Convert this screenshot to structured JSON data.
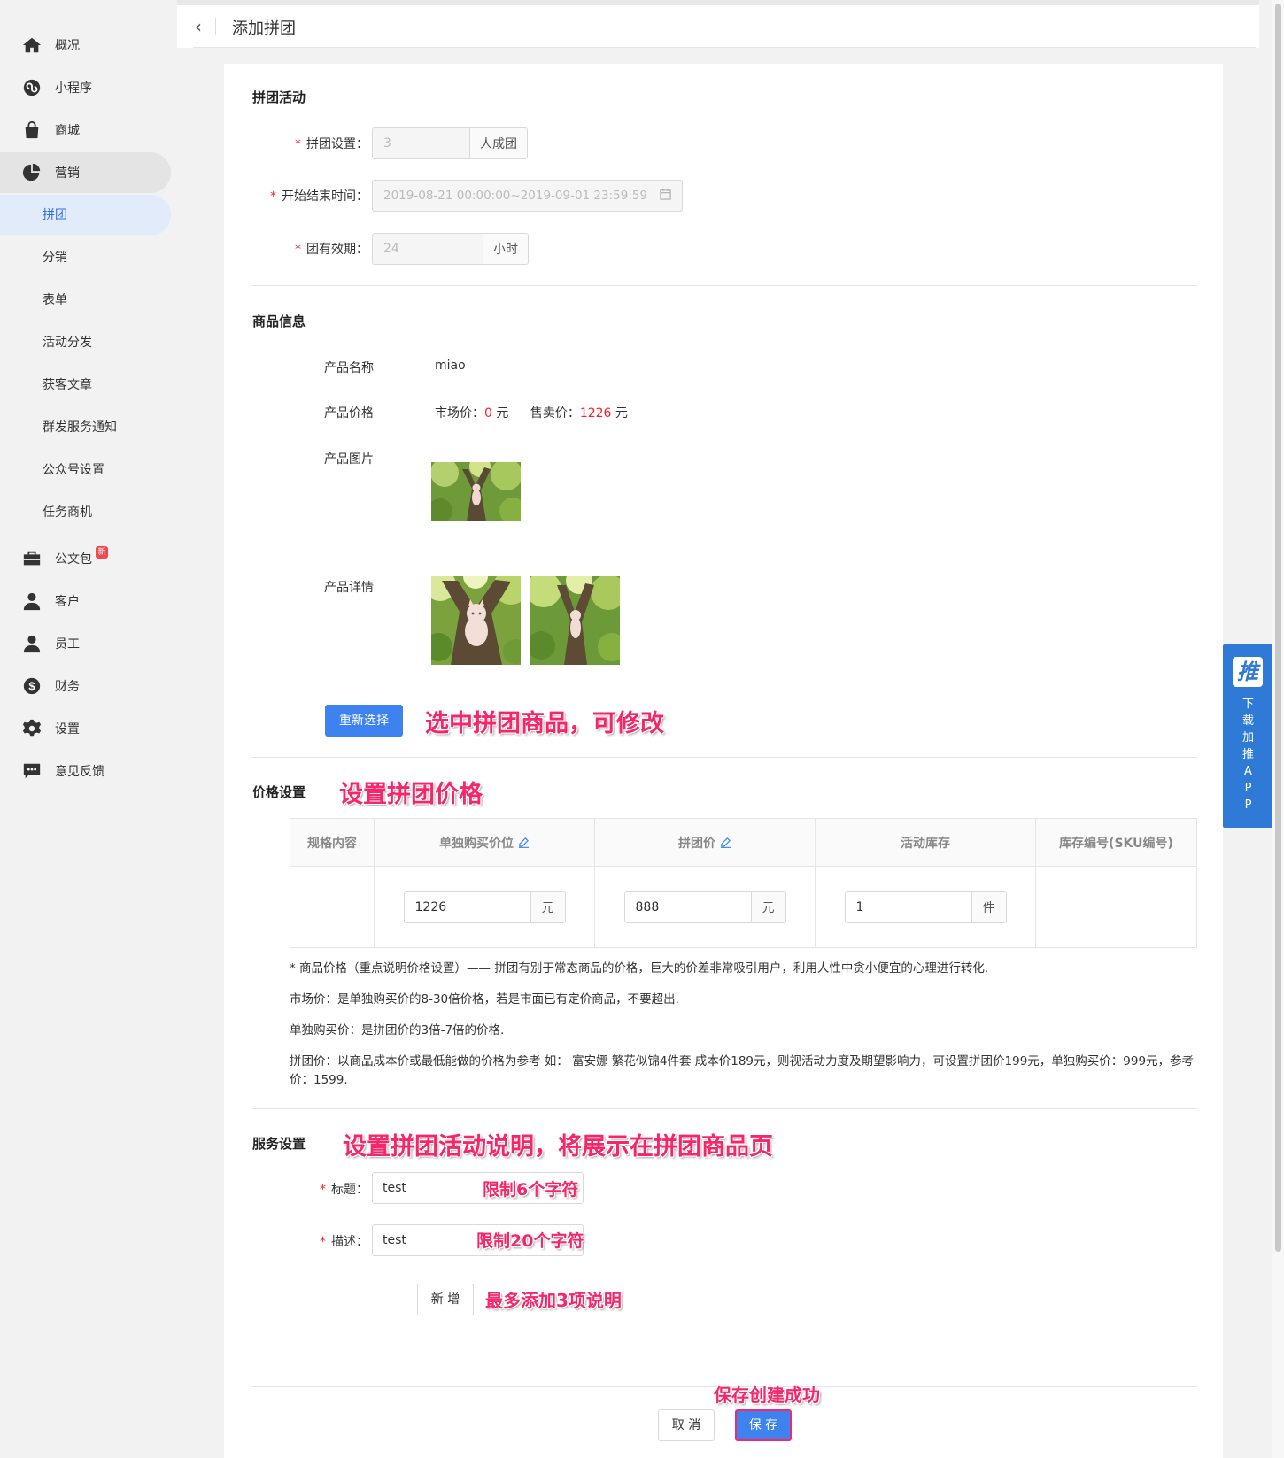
{
  "header": {
    "back_icon": "chevron-left-icon",
    "title": "添加拼团"
  },
  "sidebar": {
    "items": [
      {
        "label": "概况",
        "icon": "home-icon"
      },
      {
        "label": "小程序",
        "icon": "miniprogram-icon"
      },
      {
        "label": "商城",
        "icon": "shopping-bag-icon"
      },
      {
        "label": "营销",
        "icon": "pie-chart-icon"
      },
      {
        "label": "公文包",
        "icon": "briefcase-icon",
        "badge": "新"
      },
      {
        "label": "客户",
        "icon": "customer-icon"
      },
      {
        "label": "员工",
        "icon": "person-icon"
      },
      {
        "label": "财务",
        "icon": "dollar-icon"
      },
      {
        "label": "设置",
        "icon": "gear-icon"
      },
      {
        "label": "意见反馈",
        "icon": "feedback-icon"
      }
    ],
    "sub_items": [
      "拼团",
      "分销",
      "表单",
      "活动分发",
      "获客文章",
      "群发服务通知",
      "公众号设置",
      "任务商机"
    ],
    "active_sub": "拼团"
  },
  "activity": {
    "section_title": "拼团活动",
    "group_size": {
      "label": "拼团设置：",
      "value": "3",
      "suffix": "人成团"
    },
    "time_range": {
      "label": "开始结束时间：",
      "value": "2019-08-21 00:00:00~2019-09-01 23:59:59"
    },
    "validity": {
      "label": "团有效期：",
      "value": "24",
      "suffix": "小时"
    }
  },
  "product": {
    "section_title": "商品信息",
    "name_label": "产品名称",
    "name_value": "miao",
    "price_label": "产品价格",
    "market_price_label": "市场价：",
    "market_price": "0",
    "sale_price_label": "售卖价：",
    "sale_price": "1226",
    "currency": "元",
    "image_label": "产品图片",
    "detail_label": "产品详情",
    "reselect_button": "重新选择",
    "annotation": "选中拼团商品，可修改"
  },
  "pricing": {
    "section_title": "价格设置",
    "annotation": "设置拼团价格",
    "columns": [
      "规格内容",
      "单独购买价位",
      "拼团价",
      "活动库存",
      "库存编号(SKU编号)"
    ],
    "row": {
      "spec": "",
      "single_price": "1226",
      "single_unit": "元",
      "group_price": "888",
      "group_unit": "元",
      "stock": "1",
      "stock_unit": "件",
      "sku": ""
    },
    "notes": [
      "* 商品价格（重点说明价格设置）—— 拼团有别于常态商品的价格，巨大的价差非常吸引用户，利用人性中贪小便宜的心理进行转化.",
      "市场价：是单独购买价的8-30倍价格，若是市面已有定价商品，不要超出.",
      "单独购买价：是拼团价的3倍-7倍的价格.",
      "拼团价：以商品成本价或最低能做的价格为参考 如： 富安娜 繁花似锦4件套 成本价189元，则视活动力度及期望影响力，可设置拼团价199元，单独购买价：999元，参考价：1599."
    ]
  },
  "service": {
    "section_title": "服务设置",
    "annotation": "设置拼团活动说明，将展示在拼团商品页",
    "title_label": "标题：",
    "title_value": "test",
    "title_hint": "限制6个字符",
    "desc_label": "描述：",
    "desc_value": "test",
    "desc_hint": "限制20个字符",
    "add_button": "新 增",
    "add_hint": "最多添加3项说明"
  },
  "footer": {
    "cancel_button": "取 消",
    "save_button": "保 存",
    "save_annotation": "保存创建成功"
  },
  "float_tab": {
    "logo": "推",
    "text_chars": [
      "下",
      "载",
      "加",
      "推",
      "A",
      "P",
      "P"
    ]
  },
  "colors": {
    "primary": "#3e82f0",
    "required": "#f5222d",
    "annotation": "#f5276a",
    "float_tab": "#2f7ad7"
  }
}
